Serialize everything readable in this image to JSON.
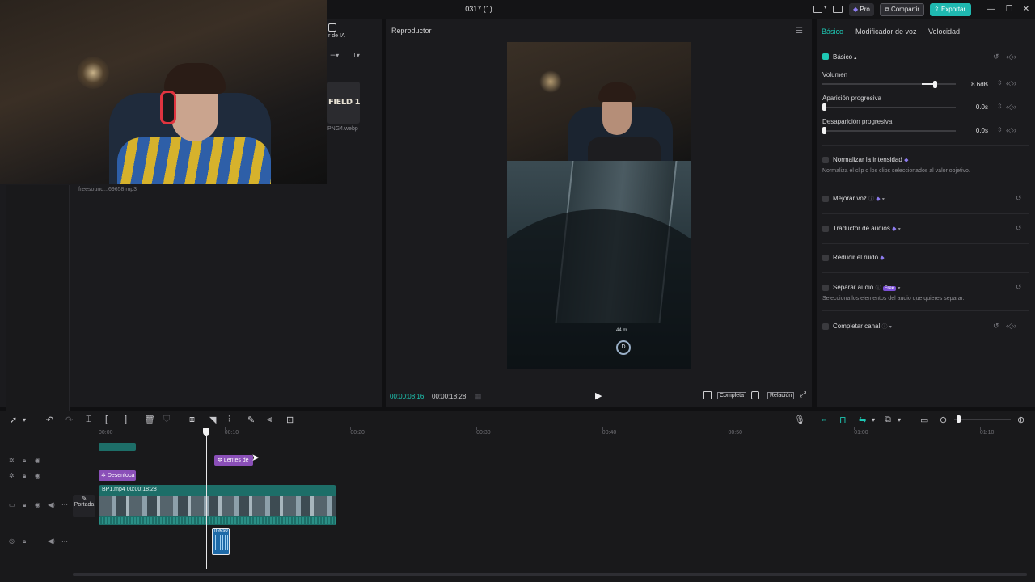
{
  "window": {
    "title": "0317 (1)"
  },
  "topbar": {
    "pro": "Pro",
    "share": "Compartir",
    "export": "Exportar"
  },
  "media": {
    "ai_label": "r de IA",
    "sticker": "FIELD 1",
    "file_webp": "PNG4.webp",
    "audio_file": "freesound...69658.mp3"
  },
  "player": {
    "title": "Reproductor",
    "current_time": "00:00:08:16",
    "total_time": "00:00:18:28",
    "full_label": "Completa",
    "ratio_label": "Relación",
    "distance": "44 m",
    "marker": "D"
  },
  "inspector": {
    "tabs": [
      "Básico",
      "Modificador de voz",
      "Velocidad"
    ],
    "section": "Básico",
    "volume_label": "Volumen",
    "volume_value": "8.6dB",
    "volume_level": 0.86,
    "fade_in_label": "Aparición progresiva",
    "fade_in_value": "0.0s",
    "fade_out_label": "Desaparición progresiva",
    "fade_out_value": "0.0s",
    "normalize_label": "Normalizar la intensidad",
    "normalize_desc": "Normaliza el clip o los clips seleccionados al valor objetivo.",
    "enhance_label": "Mejorar voz",
    "translate_label": "Traductor de audios",
    "noise_label": "Reducir el ruido",
    "separate_label": "Separar audio",
    "separate_badge": "Free",
    "separate_desc": "Selecciona los elementos del audio que quieres separar.",
    "channel_label": "Completar canal"
  },
  "timeline": {
    "ruler": [
      "00:00",
      "00:10",
      "00:20",
      "00:30",
      "00:40",
      "00:50",
      "01:00",
      "01:10"
    ],
    "effect_clip": "Lentes de",
    "blur_clip": "Desenfoca",
    "video_clip_name": "BP1.mp4",
    "video_clip_duration": "00:00:18:28",
    "cover_label": "Portada",
    "audio_clip": "freeso"
  },
  "colors": {
    "accent": "#1ec8b4",
    "export": "#1fb8b0",
    "purple": "#8a4fb8",
    "teal_track": "#1d6e68"
  }
}
